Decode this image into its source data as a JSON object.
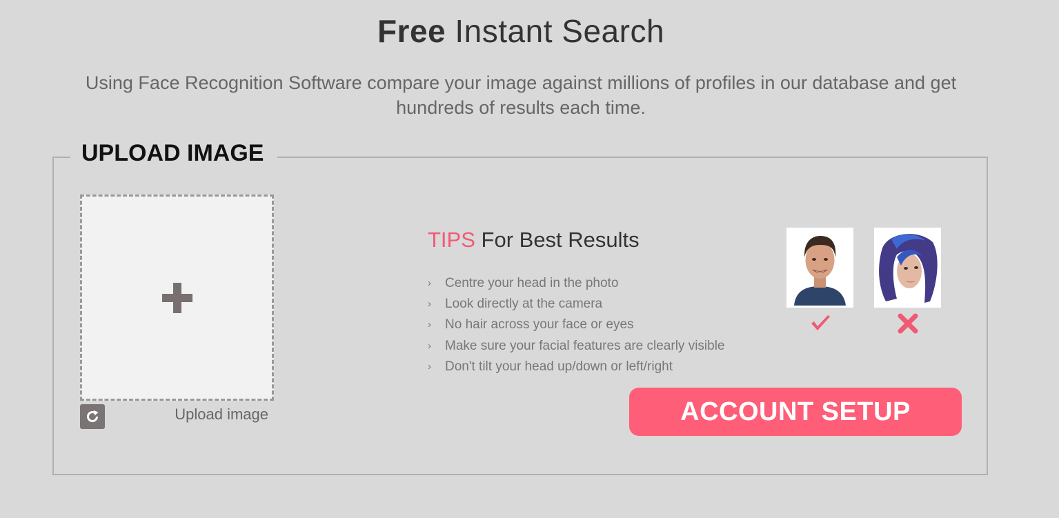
{
  "header": {
    "title_bold": "Free",
    "title_rest": "Instant Search",
    "subtitle": "Using Face Recognition Software compare your image against millions of profiles in our database and get hundreds of results each time."
  },
  "upload": {
    "legend": "UPLOAD IMAGE",
    "caption": "Upload image",
    "dropzone_icon": "plus-icon",
    "rotate_icon": "rotate-icon"
  },
  "tips": {
    "accent": "TIPS",
    "heading_rest": "For Best Results",
    "items": [
      "Centre your head in the photo",
      "Look directly at the camera",
      "No hair across your face or eyes",
      "Make sure your facial features are clearly visible",
      "Don't tilt your head up/down or left/right"
    ],
    "good_mark_icon": "check-icon",
    "bad_mark_icon": "cross-icon"
  },
  "cta": {
    "label": "ACCOUNT SETUP"
  },
  "colors": {
    "background": "#d9d9d9",
    "accent": "#f05a73",
    "button": "#ff5e78",
    "frame_border": "#b0b0b0"
  }
}
